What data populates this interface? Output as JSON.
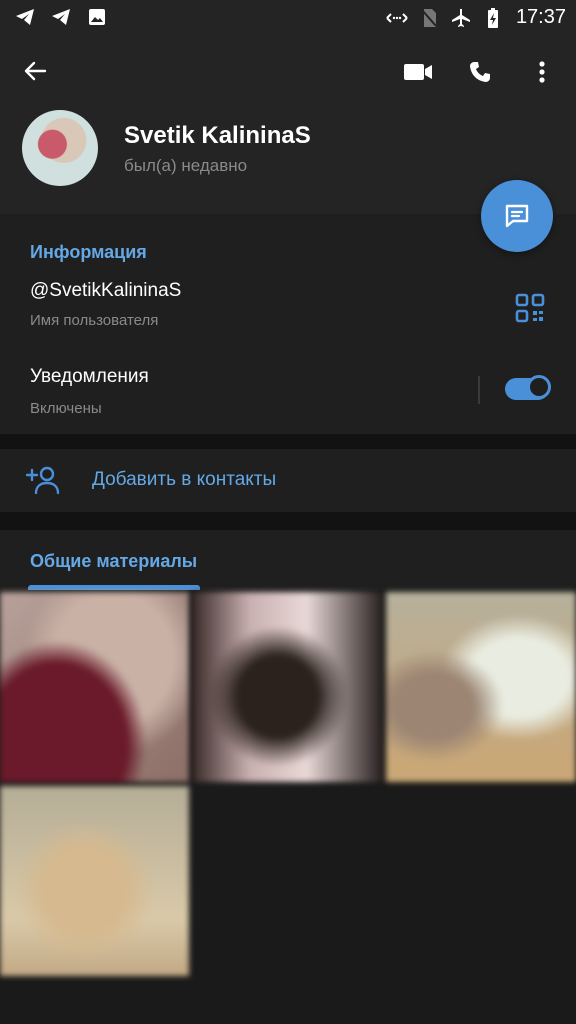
{
  "statusbar": {
    "time": "17:37"
  },
  "profile": {
    "name": "Svetik KalininaS",
    "status": "был(а) недавно"
  },
  "info": {
    "section_title": "Информация",
    "username": "@SvetikKalininaS",
    "username_label": "Имя пользователя",
    "notifications_label": "Уведомления",
    "notifications_value": "Включены",
    "notifications_enabled": true
  },
  "actions": {
    "add_contact_label": "Добавить в контакты"
  },
  "media": {
    "section_title": "Общие материалы",
    "thumb_count": 4
  },
  "icons": {
    "back": "arrow-left-icon",
    "video": "video-camera-icon",
    "call": "phone-icon",
    "menu": "more-vertical-icon",
    "message": "chat-bubble-icon",
    "qr": "qr-code-icon",
    "add_contact": "add-person-icon"
  },
  "colors": {
    "accent": "#4a90d9",
    "accent_text": "#64a8e6",
    "background": "#1a1a1a",
    "card": "#1f1f1f"
  }
}
